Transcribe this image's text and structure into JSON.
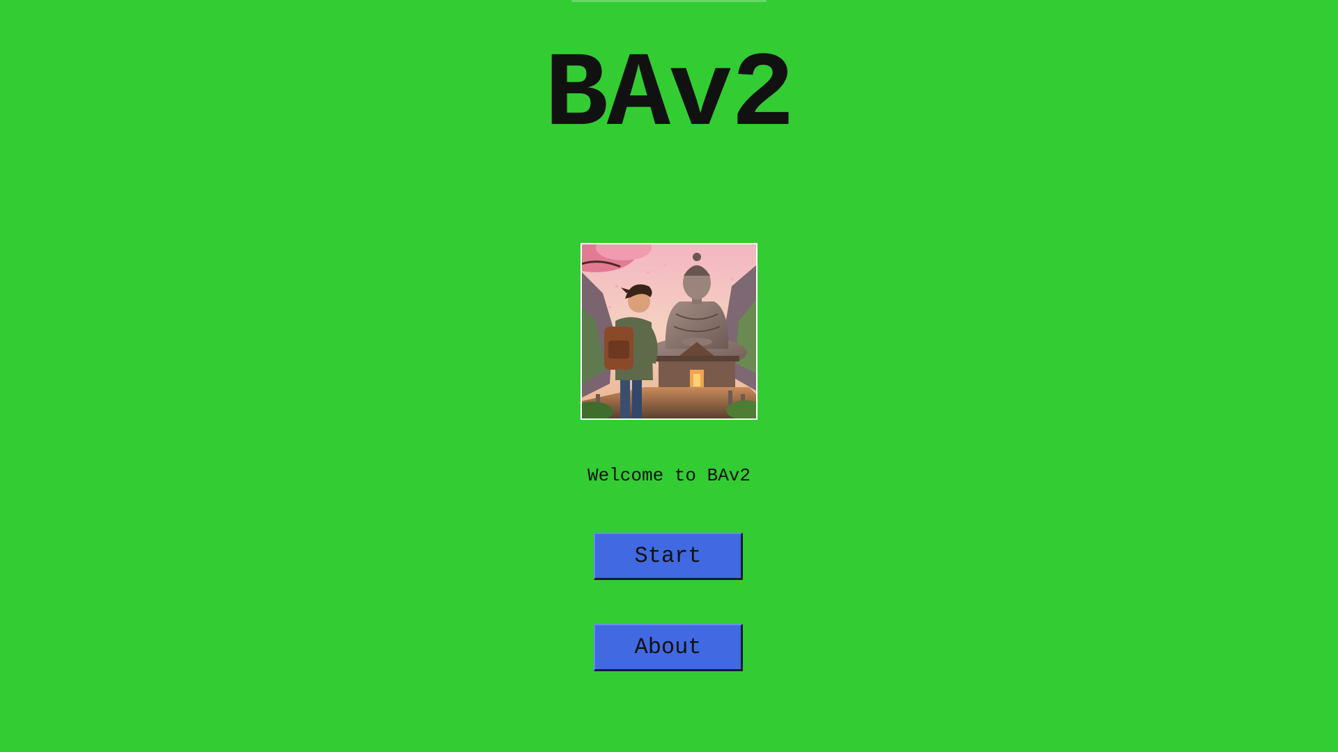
{
  "header": {
    "title": "BAv2"
  },
  "hero": {
    "image_icon": "cover-art-image"
  },
  "welcome": {
    "text": "Welcome to BAv2"
  },
  "menu": {
    "start_label": "Start",
    "about_label": "About"
  },
  "colors": {
    "background": "#33cc33",
    "button": "#4169e1",
    "text": "#111111"
  }
}
